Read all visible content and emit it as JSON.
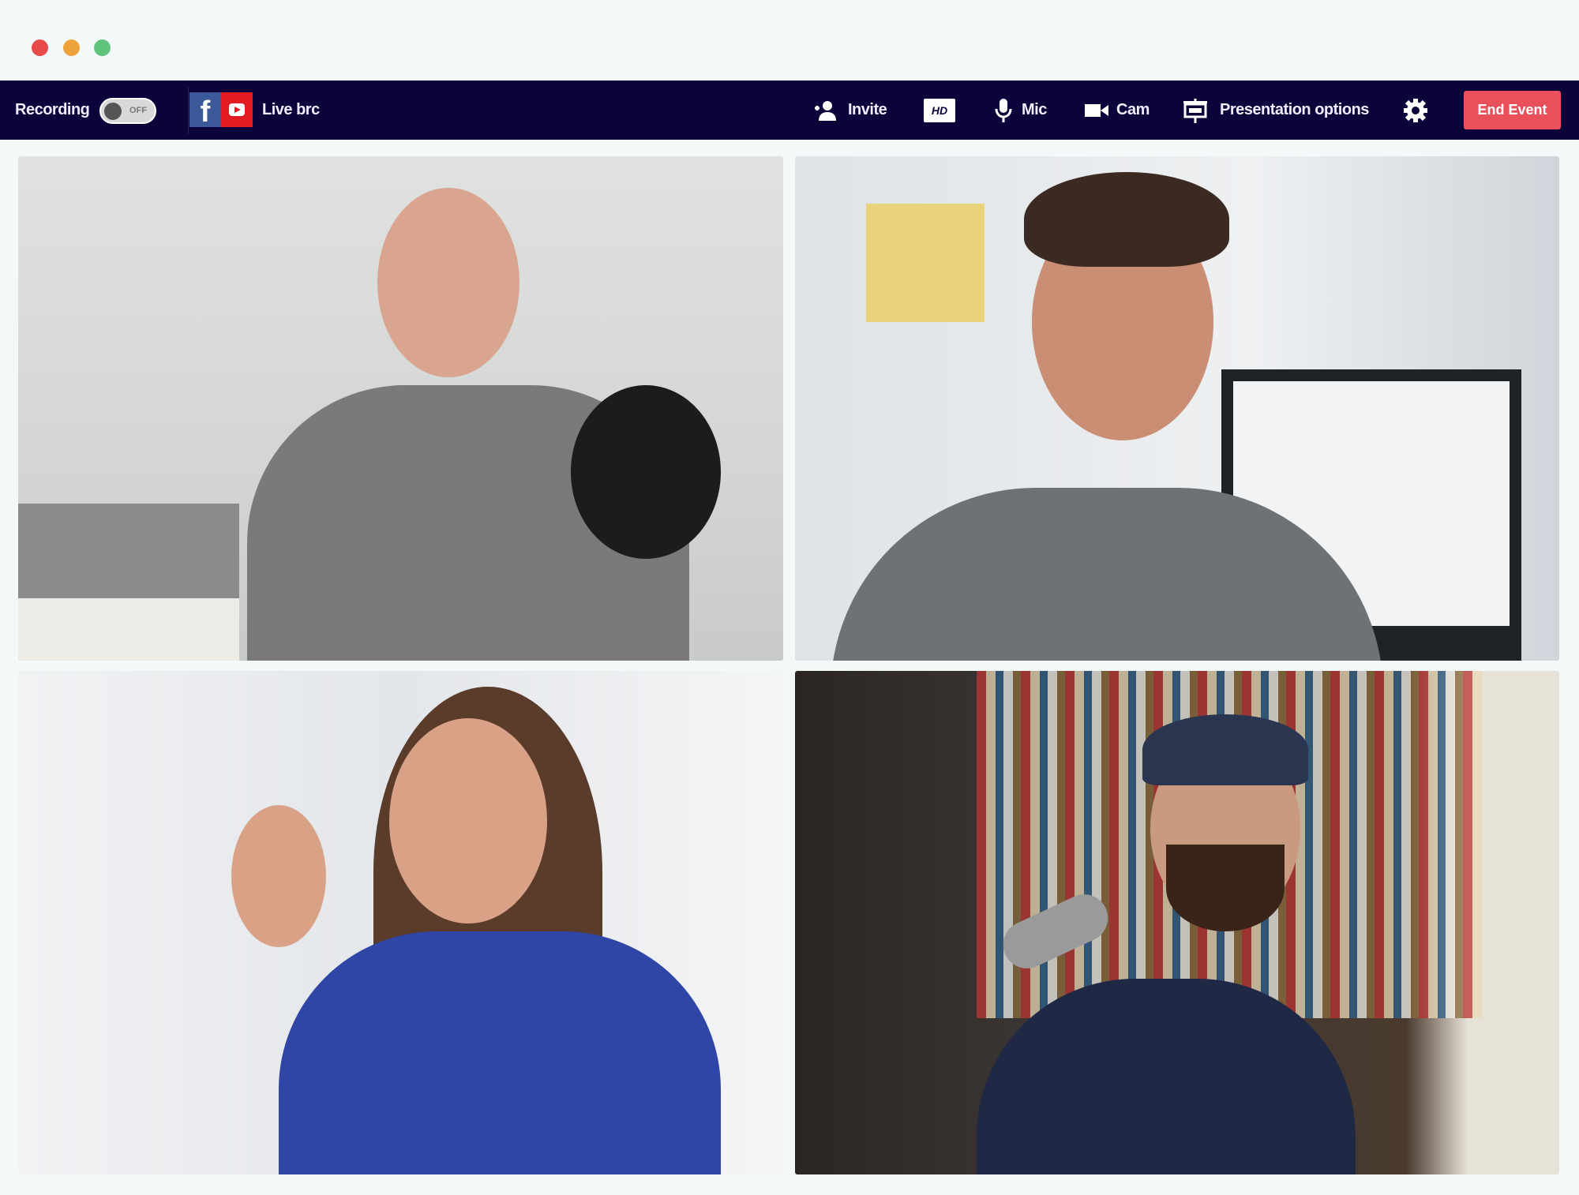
{
  "window": {
    "dots": [
      "#e94b4b",
      "#eea23b",
      "#5fc57d"
    ]
  },
  "toolbar": {
    "recording_label": "Recording",
    "recording_toggle": "OFF",
    "live_label": "Live brc",
    "invite_label": "Invite",
    "hd_label": "HD",
    "mic_label": "Mic",
    "cam_label": "Cam",
    "presentation_label": "Presentation options",
    "end_event_label": "End Event",
    "colors": {
      "bar": "#0b0339",
      "end_event": "#e9505a"
    }
  },
  "video_tiles": [
    {
      "shirt": "#7a7a78",
      "bg": "#d9dcdc"
    },
    {
      "shirt": "#6e7274",
      "bg": "#e4e8ec"
    },
    {
      "shirt": "#2f46a6",
      "bg": "#e8ebee"
    },
    {
      "shirt": "#1f2845",
      "bg": "#3a3532"
    }
  ]
}
